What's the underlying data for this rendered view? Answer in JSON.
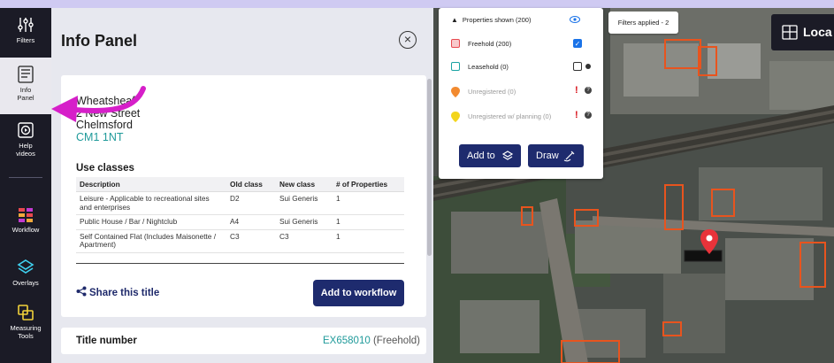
{
  "rail": {
    "items": [
      {
        "label": "Filters",
        "icon": "filters-icon"
      },
      {
        "label": "Info Panel",
        "icon": "info-panel-icon"
      },
      {
        "label": "Help videos",
        "icon": "help-videos-icon"
      },
      {
        "label": "Workflow",
        "icon": "workflow-icon"
      },
      {
        "label": "Overlays",
        "icon": "overlays-icon"
      },
      {
        "label": "Measuring Tools",
        "icon": "measuring-tools-icon"
      }
    ]
  },
  "panel": {
    "title": "Info Panel",
    "address": {
      "line1": "Wheatsheaf",
      "line2": "2 New Street",
      "line3": "Chelmsford",
      "postcode": "CM1 1NT"
    },
    "use_classes_title": "Use classes",
    "table": {
      "headers": [
        "Description",
        "Old class",
        "New class",
        "# of Properties"
      ],
      "rows": [
        [
          "Leisure - Applicable to recreational sites and enterprises",
          "D2",
          "Sui Generis",
          "1"
        ],
        [
          "Public House / Bar / Nightclub",
          "A4",
          "Sui Generis",
          "1"
        ],
        [
          "Self Contained Flat (Includes Maisonette / Apartment)",
          "C3",
          "C3",
          "1"
        ]
      ]
    },
    "share_label": "Share this title",
    "add_to_workflow_label": "Add to workflow",
    "title_number_label": "Title number",
    "title_number_value": "EX658010",
    "tenure": "(Freehold)"
  },
  "map": {
    "properties_shown": "Properties shown (200)",
    "rows": [
      {
        "label": "Freehold (200)",
        "color": "#e8494f",
        "checked": true
      },
      {
        "label": "Leasehold (0)",
        "color": "#1aa3a3",
        "checked": false
      },
      {
        "label": "Unregistered (0)",
        "color": "#f28a2f"
      },
      {
        "label": "Unregistered w/ planning (0)",
        "color": "#f3d51c"
      }
    ],
    "add_to_label": "Add to",
    "draw_label": "Draw",
    "filters_applied": "Filters applied - 2",
    "location_label": "Loca"
  },
  "colors": {
    "accent_navy": "#1e2b6e",
    "teal": "#1f9a9a",
    "annotation_magenta": "#d61fc9",
    "parcel_orange": "#e8541e"
  }
}
